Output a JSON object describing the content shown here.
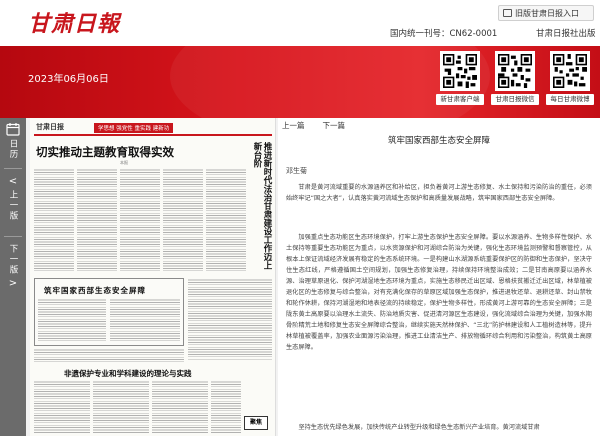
{
  "header": {
    "logo_text": "甘肃日報",
    "old_site_button": "旧版甘肃日报入口",
    "cn_number": "国内统一刊号：CN62-0001",
    "publisher": "甘肃日报社出版"
  },
  "band": {
    "date": "2023年06月06日",
    "qr_codes": [
      {
        "label": "新甘肃客户端"
      },
      {
        "label": "甘肃日报微信"
      },
      {
        "label": "每日甘肃微博"
      }
    ]
  },
  "leftnav": {
    "calendar_label": "日历",
    "prev_label": "上一版",
    "prev_arrow": "<",
    "next_label": "下一版",
    "next_arrow": ">",
    "icon_names": [
      "calendar-icon",
      "chevron-left-icon",
      "chevron-right-icon"
    ]
  },
  "paper": {
    "masthead": "甘肃日报",
    "tag_strip": "学思想 强党性 重实践 建新功",
    "main_title": "切实推动主题教育取得实效",
    "byline": "本报",
    "vertical_title": "推进新时代法治甘肃建设工作迈上新台阶",
    "article2_title": "筑牢国家西部生态安全屏障",
    "article3_title": "非遗保护专业和学科建设的理论与实践",
    "logo_text": "聚焦"
  },
  "reader": {
    "prev": "上一篇",
    "next": "下一篇",
    "title": "筑牢国家西部生态安全屏障",
    "author": "邓生菊",
    "paragraphs": [
      "甘肃是黄河流域重要的水源涵养区和补给区，担负着黄河上游生态修复、水土保持和污染防治的重任，必须始终牢记“国之大者”，认真落实黄河流域生态保护和高质量发展战略，筑牢国家西部生态安全屏障。",
      "加强重点生态功能区生态环境保护，打牢上游生态保护生态安全屏障。要以水源涵养、生物多样性保护、水土保持等重要生态功能区为重点，以水资源保护和河湖综合防治为关键，强化生态环境监测预警和督察管控，从根本上保证流域经济发展有稳定的生态系统环境。一是构建山水湖源系统重要保护区的防御和生态保护，坚决守住生态红线，严格遵循国土空间规划，加强生态修复治理，持续保持环境整治成效；二是甘南高原要以涵养水源、治理草原退化、保护河湖湿地生态环境为重点，实施生态移民迁出区域、恩格扶贫搬迁迁出区域，林草植被退化区的生态修复与综合整治，对有充满化保存的草原区域加强生态保护，推进退牧还草、退耕还草、封山禁牧和轮作休耕，保持河湖湿地和地表径流的持续稳定，保护生物多样性，形成黄河上游可靠的生态安全屏障；三是陇东黄土高原要以治理水土流失、防治地质灾害、促进清河源区生态建设，强化流域综合治理为关键，加强水期骨阶精荒土地和修复生态安全屏障综合整治，继续实施天然林保护、“三北”防护林建设和人工植树造林等，提升林草植被覆盖率，加强农业面源污染治理，推进工业清洁生产、排放物循环综合利用和污染整治，构筑黄土高原生态屏障。",
      "坚持生态优先绿色发展，加快传统产业转型升级和绿色生态新兴产业培育。黄河流域甘肃"
    ]
  }
}
